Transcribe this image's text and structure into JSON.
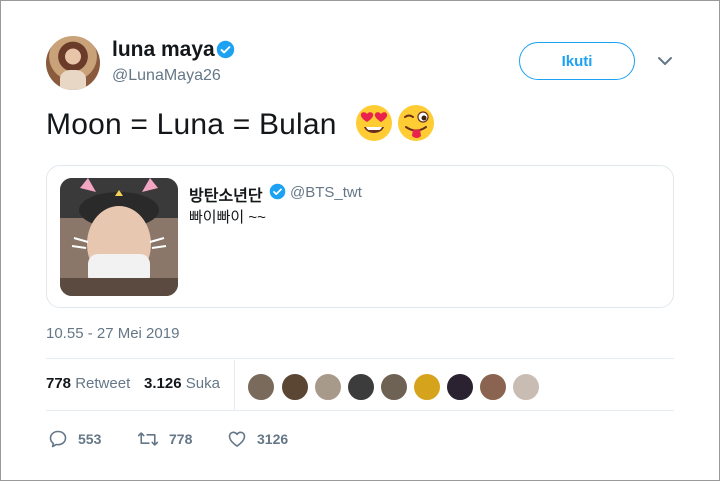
{
  "author": {
    "name": "luna maya",
    "handle": "@LunaMaya26",
    "verified": true
  },
  "follow_label": "Ikuti",
  "tweet_text": "Moon = Luna = Bulan",
  "emojis": [
    "heart-eyes-emoji",
    "winking-tongue-emoji"
  ],
  "quoted": {
    "name": "방탄소년단",
    "handle": "@BTS_twt",
    "text": "빠이빠이 ~~",
    "verified": true
  },
  "timestamp": "10.55 - 27 Mei 2019",
  "stats": {
    "retweets": "778",
    "retweets_label": "Retweet",
    "likes": "3.126",
    "likes_label": "Suka"
  },
  "actions": {
    "reply_count": "553",
    "retweet_count": "778",
    "like_count": "3126"
  },
  "colors": {
    "accent": "#1da1f2",
    "secondary_text": "#657786",
    "text": "#14171a",
    "border": "#e1e8ed"
  }
}
